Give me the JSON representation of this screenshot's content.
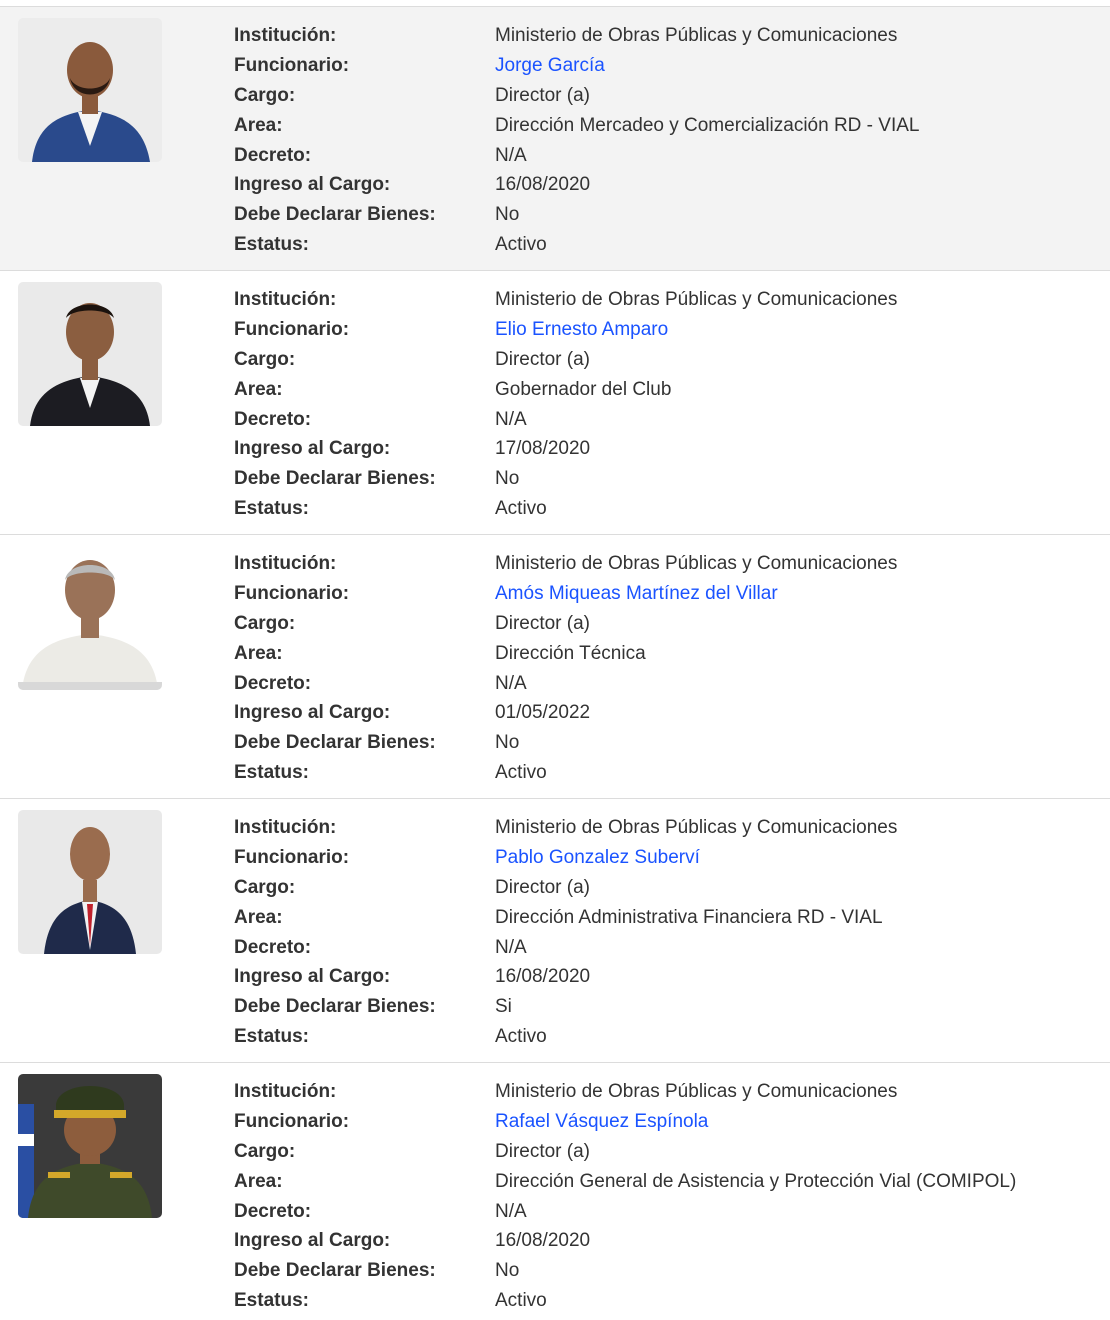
{
  "labels": {
    "institucion": "Institución:",
    "funcionario": "Funcionario:",
    "cargo": "Cargo:",
    "area": "Area:",
    "decreto": "Decreto:",
    "ingreso": "Ingreso al Cargo:",
    "declarar": "Debe Declarar Bienes:",
    "estatus": "Estatus:"
  },
  "colors": {
    "link": "#1a53ff",
    "row_shade": "#f3f3f3",
    "divider": "#dcdcdc",
    "text": "#333333"
  },
  "records": [
    {
      "photo": "official-portrait-photo",
      "institucion": "Ministerio de Obras Públicas y Comunicaciones",
      "funcionario": "Jorge García",
      "cargo": "Director (a)",
      "area": "Dirección Mercadeo y Comercialización RD - VIAL",
      "decreto": "N/A",
      "ingreso": "16/08/2020",
      "declarar": "No",
      "estatus": "Activo"
    },
    {
      "photo": "official-portrait-photo",
      "institucion": "Ministerio de Obras Públicas y Comunicaciones",
      "funcionario": "Elio Ernesto Amparo",
      "cargo": "Director (a)",
      "area": "Gobernador del Club",
      "decreto": "N/A",
      "ingreso": "17/08/2020",
      "declarar": "No",
      "estatus": "Activo"
    },
    {
      "photo": "official-portrait-photo",
      "institucion": "Ministerio de Obras Públicas y Comunicaciones",
      "funcionario": "Amós Miqueas Martínez del Villar",
      "cargo": "Director (a)",
      "area": "Dirección Técnica",
      "decreto": "N/A",
      "ingreso": "01/05/2022",
      "declarar": "No",
      "estatus": "Activo"
    },
    {
      "photo": "official-portrait-photo",
      "institucion": "Ministerio de Obras Públicas y Comunicaciones",
      "funcionario": "Pablo Gonzalez Suberví",
      "cargo": "Director (a)",
      "area": "Dirección Administrativa Financiera RD - VIAL",
      "decreto": "N/A",
      "ingreso": "16/08/2020",
      "declarar": "Si",
      "estatus": "Activo"
    },
    {
      "photo": "official-portrait-photo",
      "institucion": "Ministerio de Obras Públicas y Comunicaciones",
      "funcionario": "Rafael Vásquez Espínola",
      "cargo": "Director (a)",
      "area": "Dirección General de Asistencia y Protección Vial (COMIPOL)",
      "decreto": "N/A",
      "ingreso": "16/08/2020",
      "declarar": "No",
      "estatus": "Activo"
    }
  ]
}
